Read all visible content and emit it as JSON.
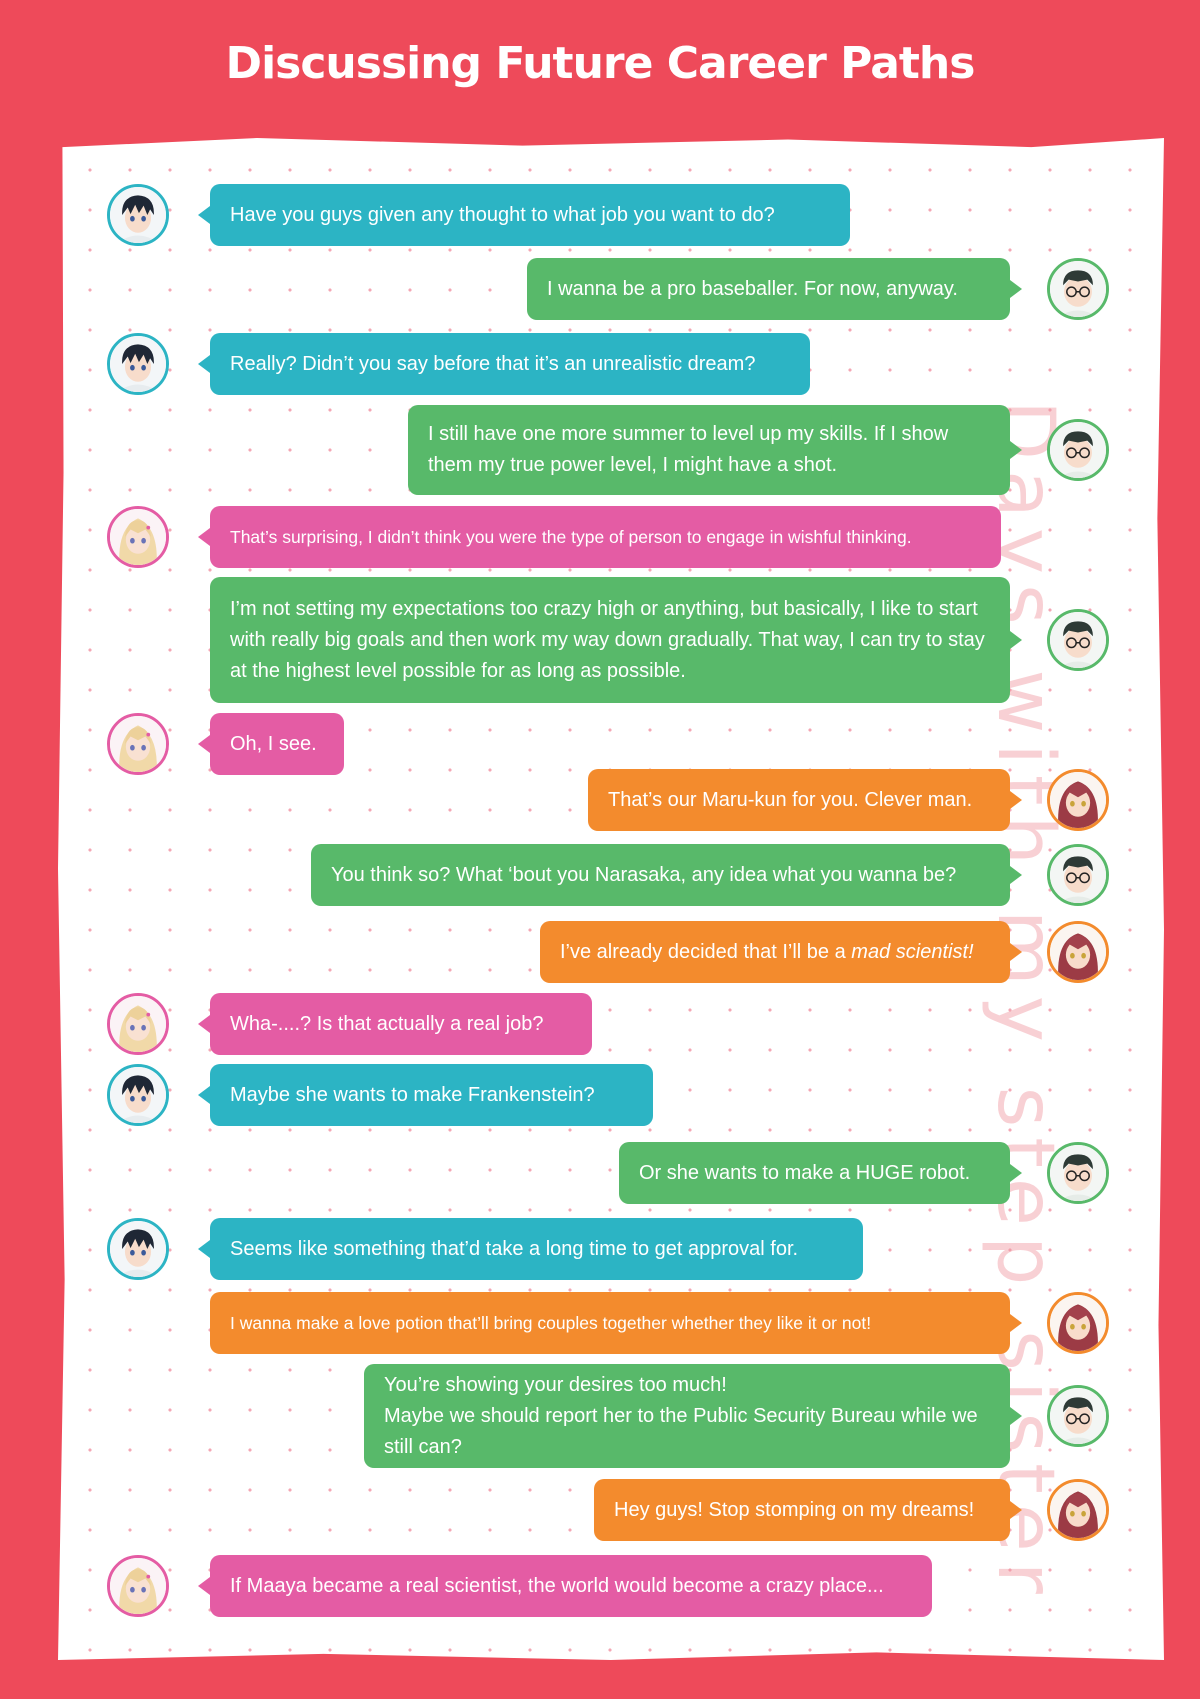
{
  "title": "Discussing Future Career Paths",
  "watermark": "Days with my step sister",
  "colors": {
    "background": "#ee4a5a",
    "teal": "#2cb4c4",
    "green": "#58b96a",
    "pink": "#e45ca4",
    "orange": "#f38b2d"
  },
  "messages": [
    {
      "speaker": "boy-black-hair",
      "color": "teal",
      "side": "left",
      "text": "Have you guys given any thought to what job you want to do?"
    },
    {
      "speaker": "boy-glasses",
      "color": "green",
      "side": "right",
      "text": "I wanna be a pro baseballer. For now, anyway."
    },
    {
      "speaker": "boy-black-hair",
      "color": "teal",
      "side": "left",
      "text": "Really? Didn’t you say before that it’s an unrealistic dream?"
    },
    {
      "speaker": "boy-glasses",
      "color": "green",
      "side": "right",
      "text": "I still have one more summer to level up my skills. If I show them my true power level, I might have a shot."
    },
    {
      "speaker": "girl-blonde",
      "color": "pink",
      "side": "left",
      "text": "That’s surprising, I didn’t think you were the type of person to engage in wishful thinking."
    },
    {
      "speaker": "boy-glasses",
      "color": "green",
      "side": "right",
      "text": "I’m not setting my expectations too crazy high or anything, but basically, I like to start with really big goals and then work my way down gradually. That way, I can try to stay at the highest level possible for as long as possible."
    },
    {
      "speaker": "girl-blonde",
      "color": "pink",
      "side": "left",
      "text": "Oh, I see."
    },
    {
      "speaker": "girl-red-hair",
      "color": "orange",
      "side": "right",
      "text": "That’s our Maru-kun for you. Clever man."
    },
    {
      "speaker": "boy-glasses",
      "color": "green",
      "side": "right",
      "text": "You think so? What ‘bout you Narasaka, any idea what you wanna be?"
    },
    {
      "speaker": "girl-red-hair",
      "color": "orange",
      "side": "right",
      "text": "I’ve already decided that I’ll be a ",
      "emph": "mad scientist!"
    },
    {
      "speaker": "girl-blonde",
      "color": "pink",
      "side": "left",
      "text": "Wha-....? Is that actually a real job?"
    },
    {
      "speaker": "boy-black-hair",
      "color": "teal",
      "side": "left",
      "text": "Maybe she wants to make Frankenstein?"
    },
    {
      "speaker": "boy-glasses",
      "color": "green",
      "side": "right",
      "text": "Or she wants to make a HUGE robot."
    },
    {
      "speaker": "boy-black-hair",
      "color": "teal",
      "side": "left",
      "text": "Seems like something that’d take a long time to get approval for."
    },
    {
      "speaker": "girl-red-hair",
      "color": "orange",
      "side": "right",
      "text": "I wanna make a love potion that’ll bring couples together whether they like it or not!"
    },
    {
      "speaker": "boy-glasses",
      "color": "green",
      "side": "right",
      "text": "You’re showing your desires too much!\nMaybe we should report her to the Public Security Bureau while we still can?"
    },
    {
      "speaker": "girl-red-hair",
      "color": "orange",
      "side": "right",
      "text": "Hey guys! Stop stomping on my dreams!"
    },
    {
      "speaker": "girl-blonde",
      "color": "pink",
      "side": "left",
      "text": "If Maaya became a real scientist, the world would become a crazy place..."
    }
  ]
}
